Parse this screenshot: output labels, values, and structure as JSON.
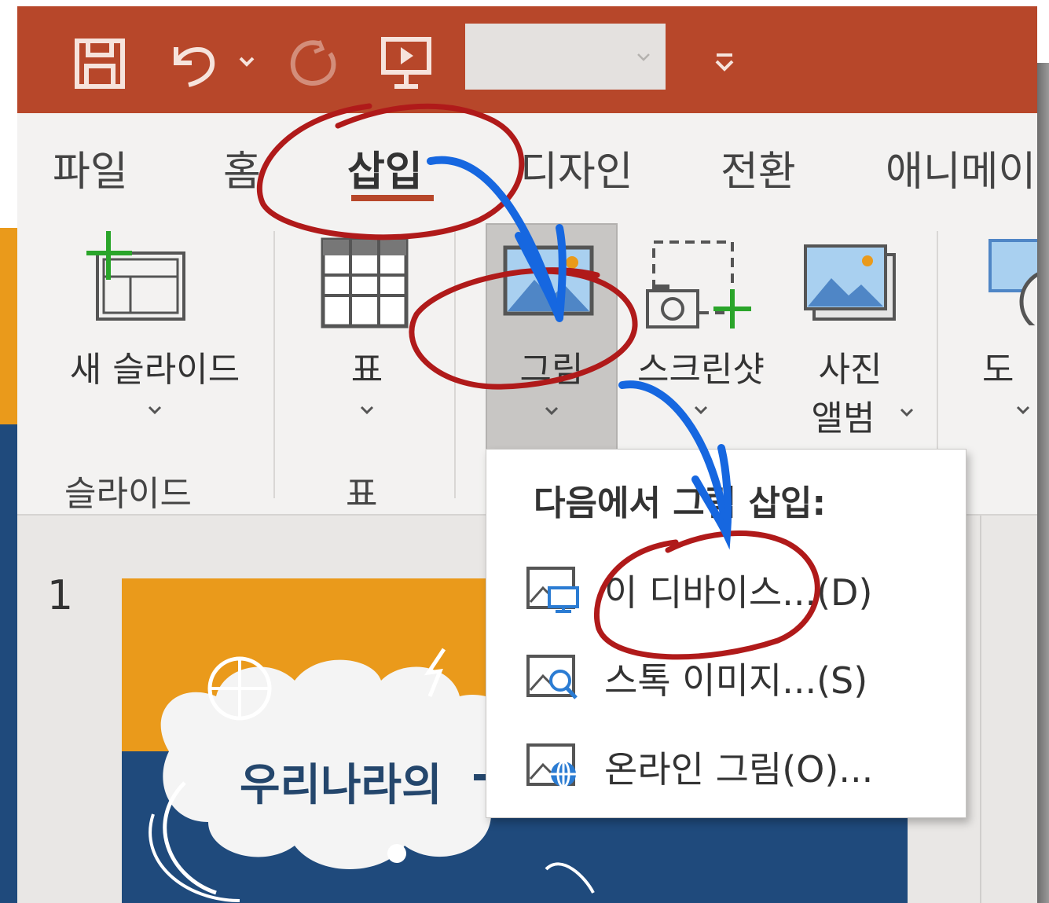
{
  "quick_access": {
    "save_icon": "save-icon",
    "undo_icon": "undo-icon",
    "redo_icon": "redo-icon",
    "present_icon": "start-presentation-icon",
    "combo_value": "",
    "customize_icon": "customize-qat-icon"
  },
  "tabs": {
    "file": "파일",
    "home": "홈",
    "insert": "삽입",
    "design": "디자인",
    "transitions": "전환",
    "animations": "애니메이"
  },
  "ribbon": {
    "new_slide_label": "새 슬라이드",
    "slides_group": "슬라이드",
    "table_label": "표",
    "table_group": "표",
    "picture_label": "그림",
    "screenshot_label": "스크린샷",
    "photo_album_line1": "사진",
    "photo_album_line2": "앨범",
    "shapes_label": "도",
    "accent_color": "#b7472a"
  },
  "slide_pane": {
    "slide_number": "1",
    "slide_title": "우리나라의",
    "slide_title_tail": "-"
  },
  "picture_menu": {
    "header": "다음에서 그림 삽입:",
    "items": [
      {
        "label": "이 디바이스...(D)",
        "icon": "device-picture-icon"
      },
      {
        "label": "스톡 이미지...(S)",
        "icon": "stock-image-icon"
      },
      {
        "label": "온라인 그림(O)...",
        "icon": "online-picture-icon"
      }
    ]
  },
  "annotation_colors": {
    "circle": "#b01a1a",
    "arrow": "#1667e0"
  }
}
